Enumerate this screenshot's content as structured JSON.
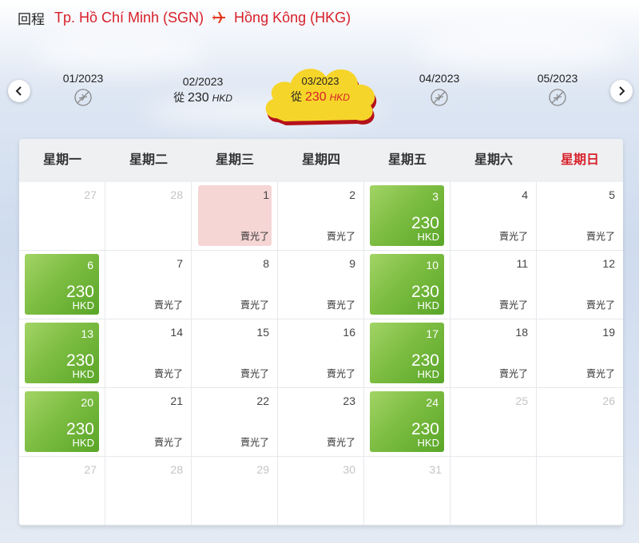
{
  "header": {
    "label": "回程",
    "origin": "Tp. Hồ Chí Minh (SGN)",
    "destination": "Hồng Kông (HKG)",
    "plane_icon": "plane-icon"
  },
  "months": [
    {
      "label": "01/2023",
      "available": false
    },
    {
      "label": "02/2023",
      "available": true,
      "from": "從",
      "price": "230",
      "currency": "HKD"
    },
    {
      "label": "03/2023",
      "available": true,
      "from": "從",
      "price": "230",
      "currency": "HKD",
      "selected": true
    },
    {
      "label": "04/2023",
      "available": false
    },
    {
      "label": "05/2023",
      "available": false
    }
  ],
  "weekdays": [
    "星期一",
    "星期二",
    "星期三",
    "星期四",
    "星期五",
    "星期六",
    "星期日"
  ],
  "sold_out_label": "賣光了",
  "days": [
    {
      "day": "27",
      "state": "other"
    },
    {
      "day": "28",
      "state": "other"
    },
    {
      "day": "1",
      "state": "today"
    },
    {
      "day": "2",
      "state": "soldout"
    },
    {
      "day": "3",
      "state": "fare",
      "price": "230",
      "currency": "HKD"
    },
    {
      "day": "4",
      "state": "soldout"
    },
    {
      "day": "5",
      "state": "soldout"
    },
    {
      "day": "6",
      "state": "fare",
      "price": "230",
      "currency": "HKD"
    },
    {
      "day": "7",
      "state": "soldout"
    },
    {
      "day": "8",
      "state": "soldout"
    },
    {
      "day": "9",
      "state": "soldout"
    },
    {
      "day": "10",
      "state": "fare",
      "price": "230",
      "currency": "HKD"
    },
    {
      "day": "11",
      "state": "soldout"
    },
    {
      "day": "12",
      "state": "soldout"
    },
    {
      "day": "13",
      "state": "fare",
      "price": "230",
      "currency": "HKD"
    },
    {
      "day": "14",
      "state": "soldout"
    },
    {
      "day": "15",
      "state": "soldout"
    },
    {
      "day": "16",
      "state": "soldout"
    },
    {
      "day": "17",
      "state": "fare",
      "price": "230",
      "currency": "HKD"
    },
    {
      "day": "18",
      "state": "soldout"
    },
    {
      "day": "19",
      "state": "soldout"
    },
    {
      "day": "20",
      "state": "fare",
      "price": "230",
      "currency": "HKD"
    },
    {
      "day": "21",
      "state": "soldout"
    },
    {
      "day": "22",
      "state": "soldout"
    },
    {
      "day": "23",
      "state": "soldout"
    },
    {
      "day": "24",
      "state": "fare",
      "price": "230",
      "currency": "HKD"
    },
    {
      "day": "25",
      "state": "other"
    },
    {
      "day": "26",
      "state": "other"
    },
    {
      "day": "27",
      "state": "other"
    },
    {
      "day": "28",
      "state": "other"
    },
    {
      "day": "29",
      "state": "other"
    },
    {
      "day": "30",
      "state": "other"
    },
    {
      "day": "31",
      "state": "other"
    },
    {
      "day": "",
      "state": "empty"
    },
    {
      "day": "",
      "state": "empty"
    }
  ],
  "colors": {
    "accent": "#d8202a",
    "fare_green": "#7dbd42",
    "today_pink": "#f6d5d5",
    "cloud_yellow": "#f5d21c"
  },
  "icons": {
    "prev": "chevron-left-icon",
    "next": "chevron-right-icon",
    "no_flight": "no-flight-icon"
  }
}
